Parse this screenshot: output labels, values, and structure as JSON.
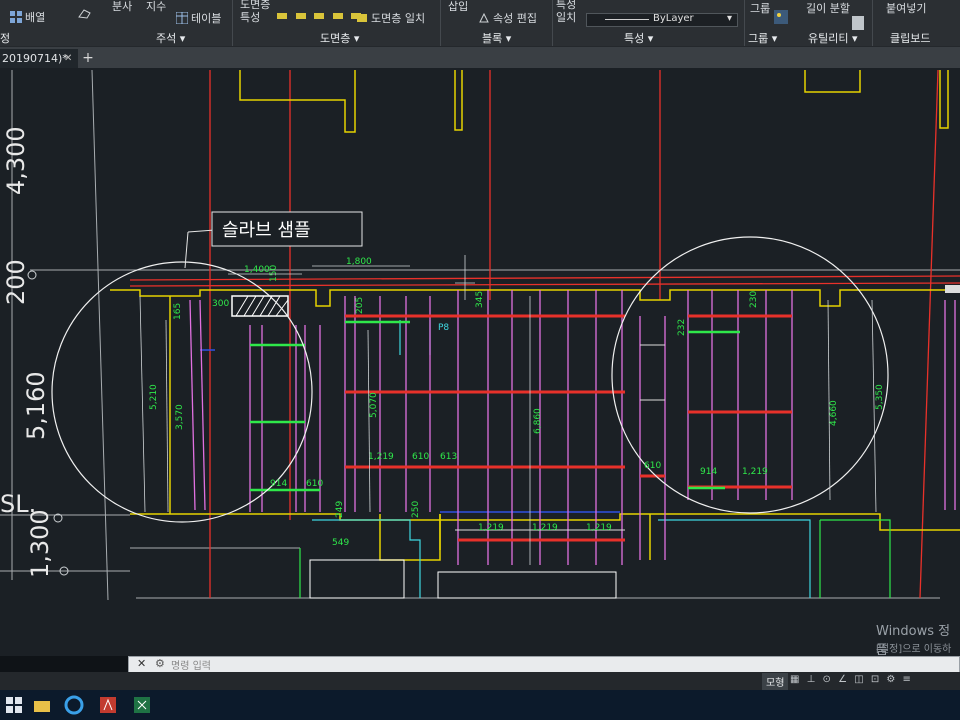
{
  "ribbon": {
    "arrange_label": "배열",
    "split_label": "분사",
    "scale_label": "지수",
    "table_label": "테이블",
    "layer_props_label": "도면층\n특성",
    "layer_match_label": "도면층 일치",
    "insert_label": "삽입",
    "edit_attr_label": "속성 편집",
    "match_props_label": "특성\n일치",
    "bylayer_value": "ByLayer",
    "group_label": "그룹",
    "measure_label": "길이 분할",
    "paste_label": "붙여넣기",
    "groups": {
      "modify": "정",
      "annotation": "주석",
      "layers": "도면층",
      "block": "블록",
      "properties": "특성",
      "groups": "그룹",
      "utilities": "유틸리티",
      "clipboard": "클립보드"
    }
  },
  "tabs": {
    "document": "20190714)*",
    "new_tab": "+"
  },
  "drawing": {
    "callout_label": "슬라브 샘플",
    "left_dims": {
      "d1": "4,300",
      "d2": "200",
      "d3": "5,160",
      "d4": "SL.",
      "d5": "1,300"
    },
    "dims": {
      "d1400": "1,400",
      "d1800": "1,800",
      "d150": "150",
      "d300": "300",
      "d165": "165",
      "d5210": "5,210",
      "d3570": "3,570",
      "d205": "205",
      "d5070": "5,070",
      "dP8": "P8",
      "d345": "345",
      "d6860": "6,860",
      "d1219a": "1,219",
      "d610a": "610",
      "d613": "613",
      "d914a": "914",
      "d610b": "610",
      "d249": "249",
      "d250": "250",
      "d549": "549",
      "d1219b": "1,219",
      "d1219c": "1,219",
      "d1219d": "1,219",
      "d610c": "610",
      "d914b": "914",
      "d1219e": "1,219",
      "d4660": "4,660",
      "d5350": "5,350",
      "d232": "232",
      "d230": "230"
    }
  },
  "cmd": {
    "close": "✕",
    "wrench": "🔧",
    "placeholder": "명령 입력"
  },
  "status": {
    "model": "모형"
  },
  "watermark": {
    "line1": "Windows 정품",
    "line2": "[설정]으로 이동하여"
  },
  "colors": {
    "ribbon_bg": "#2b2f33",
    "canvas_bg": "#1b2025",
    "red": "#e8312a",
    "yellow": "#e6d200",
    "white": "#e6e6e6",
    "magenta": "#e070e0",
    "green": "#2fe84a",
    "cyan": "#3fd7e0"
  }
}
